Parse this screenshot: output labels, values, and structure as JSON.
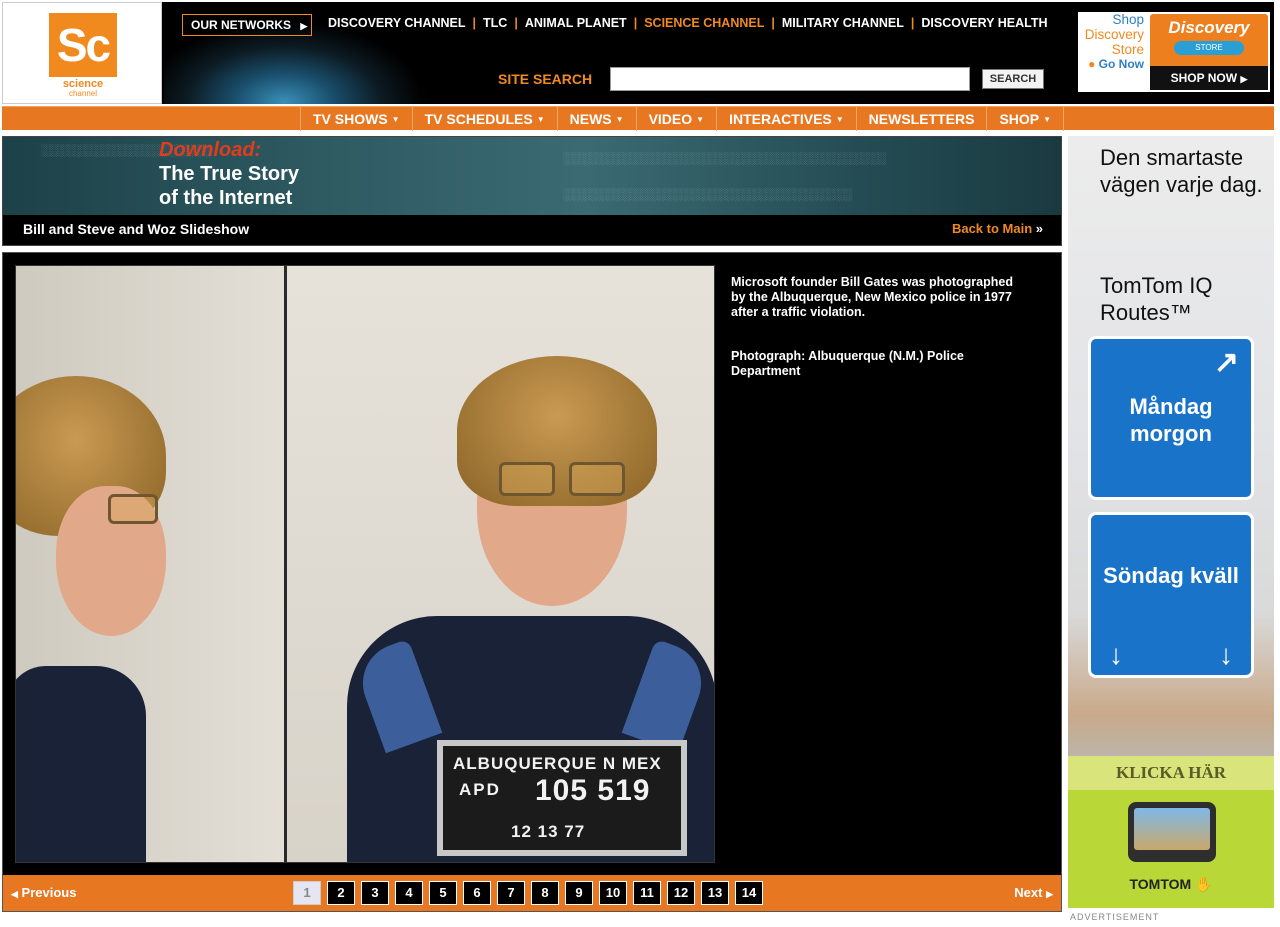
{
  "logo": {
    "abbr": "Sc",
    "word1": "science",
    "word2": "channel"
  },
  "header": {
    "our_networks": "OUR NETWORKS",
    "networks": [
      "DISCOVERY CHANNEL",
      "TLC",
      "ANIMAL PLANET",
      "SCIENCE CHANNEL",
      "MILITARY CHANNEL",
      "DISCOVERY HEALTH"
    ],
    "active_network": "SCIENCE CHANNEL",
    "site_search_label": "SITE SEARCH",
    "search_value": "",
    "search_button": "SEARCH"
  },
  "store_ad": {
    "line1": "Shop",
    "line2": "Discovery",
    "line3": "Store",
    "go_now": "Go Now",
    "brand": "Discovery",
    "brand_sub": "STORE",
    "shop_now": "SHOP NOW"
  },
  "main_nav": [
    {
      "label": "TV SHOWS",
      "dropdown": true
    },
    {
      "label": "TV SCHEDULES",
      "dropdown": true
    },
    {
      "label": "NEWS",
      "dropdown": true
    },
    {
      "label": "VIDEO",
      "dropdown": true
    },
    {
      "label": "INTERACTIVES",
      "dropdown": true
    },
    {
      "label": "NEWSLETTERS",
      "dropdown": false
    },
    {
      "label": "SHOP",
      "dropdown": true
    }
  ],
  "banner": {
    "download": "Download:",
    "line1": "The True Story",
    "line2": "of the Internet",
    "slideshow_title": "Bill and Steve and Woz Slideshow",
    "back_to_main": "Back to Main"
  },
  "slide": {
    "caption": "Microsoft founder Bill Gates was photographed by the Albuquerque, New Mexico police in 1977 after a traffic violation.",
    "credit": "Photograph: Albuquerque (N.M.) Police Department",
    "placard": {
      "line1": "ALBUQUERQUE  N MEX",
      "apd": "APD",
      "number": "105 519",
      "date": "12 13 77"
    }
  },
  "pager": {
    "previous": "Previous",
    "next": "Next",
    "pages": [
      "1",
      "2",
      "3",
      "4",
      "5",
      "6",
      "7",
      "8",
      "9",
      "10",
      "11",
      "12",
      "13",
      "14"
    ],
    "current_page": "1"
  },
  "side_ad": {
    "headline": "Den smartaste vägen varje dag.",
    "product": "TomTom IQ Routes™",
    "sign1": "Måndag morgon",
    "sign2": "Söndag kväll",
    "cta": "KLICKA HÄR",
    "logo": "TOMTOM",
    "label": "ADVERTISEMENT"
  },
  "colors": {
    "accent": "#e87722",
    "brand_orange": "#f08a1f",
    "sign_blue": "#1973c9",
    "ad_green": "#b9d736"
  }
}
